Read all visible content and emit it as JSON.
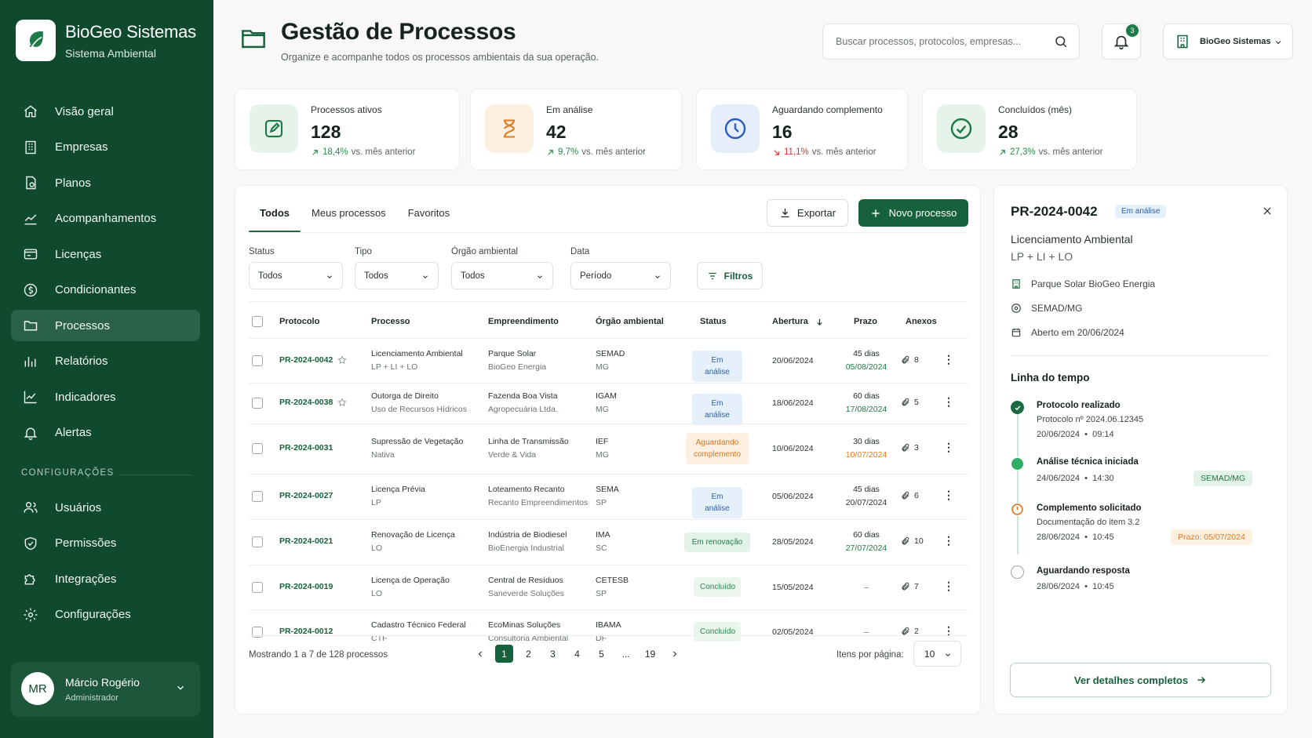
{
  "brand": {
    "title": "BioGeo Sistemas",
    "subtitle": "Sistema Ambiental"
  },
  "nav": [
    {
      "label": "Visão geral",
      "icon": "home-icon"
    },
    {
      "label": "Empresas",
      "icon": "building-icon"
    },
    {
      "label": "Planos",
      "icon": "document-icon"
    },
    {
      "label": "Acompanhamentos",
      "icon": "chart-user-icon"
    },
    {
      "label": "Licenças",
      "icon": "license-icon"
    },
    {
      "label": "Condicionantes",
      "icon": "dollar-circle-icon"
    },
    {
      "label": "Processos",
      "icon": "folder-icon",
      "active": true
    },
    {
      "label": "Relatórios",
      "icon": "bar-chart-icon"
    },
    {
      "label": "Indicadores",
      "icon": "line-chart-icon"
    },
    {
      "label": "Alertas",
      "icon": "bell-icon"
    }
  ],
  "config_section": "CONFIGURAÇÕES",
  "config_nav": [
    {
      "label": "Usuários",
      "icon": "users-icon"
    },
    {
      "label": "Permissões",
      "icon": "shield-icon"
    },
    {
      "label": "Integrações",
      "icon": "puzzle-icon"
    },
    {
      "label": "Configurações",
      "icon": "gear-icon"
    }
  ],
  "user": {
    "initials": "MR",
    "name": "Márcio Rogério",
    "role": "Administrador"
  },
  "header": {
    "title": "Gestão de Processos",
    "subtitle": "Organize e acompanhe todos os processos ambientais da sua operação.",
    "search_placeholder": "Buscar processos, protocolos, empresas...",
    "notifications": "3",
    "org": "BioGeo Sistemas"
  },
  "kpis": [
    {
      "label": "Processos ativos",
      "value": "128",
      "trend": "18,4%",
      "trend_text": "vs. mês anterior",
      "direction": "up",
      "color": "#2d8a50"
    },
    {
      "label": "Em análise",
      "value": "42",
      "trend": "9,7%",
      "trend_text": "vs. mês anterior",
      "direction": "up",
      "color": "#2d8a50"
    },
    {
      "label": "Aguardando complemento",
      "value": "16",
      "trend": "11,1%",
      "trend_text": "vs. mês anterior",
      "direction": "down",
      "color": "#d23b2f"
    },
    {
      "label": "Concluídos (mês)",
      "value": "28",
      "trend": "27,3%",
      "trend_text": "vs. mês anterior",
      "direction": "up",
      "color": "#2d8a50"
    }
  ],
  "tabs": [
    "Todos",
    "Meus processos",
    "Favoritos"
  ],
  "buttons": {
    "export": "Exportar",
    "new": "Novo processo",
    "filters": "Filtros",
    "details": "Ver detalhes completos"
  },
  "filters": [
    {
      "label": "Status",
      "value": "Todos"
    },
    {
      "label": "Tipo",
      "value": "Todos"
    },
    {
      "label": "Órgão ambiental",
      "value": "Todos"
    },
    {
      "label": "Data",
      "value": "Período"
    }
  ],
  "columns": [
    "Protocolo",
    "Processo",
    "Empreendimento",
    "Órgão ambiental",
    "Status",
    "Abertura",
    "Prazo",
    "Anexos"
  ],
  "rows": [
    {
      "protocol": "PR-2024-0042",
      "star": true,
      "process": "Licenciamento Ambiental",
      "process_sub": "LP + LI + LO",
      "enterprise": "Parque Solar",
      "enterprise_sub": "BioGeo Energia",
      "agency": "SEMAD",
      "state": "MG",
      "status": "Em análise",
      "status_type": "analise",
      "opened": "20/06/2024",
      "prazo_days": "45 dias",
      "prazo_date": "05/08/2024",
      "prazo_color": "#1f7a45",
      "attachments": "8"
    },
    {
      "protocol": "PR-2024-0038",
      "star": true,
      "process": "Outorga de Direito",
      "process_sub": "Uso de Recursos Hídricos",
      "enterprise": "Fazenda Boa Vista",
      "enterprise_sub": "Agropecuária Ltda.",
      "agency": "IGAM",
      "state": "MG",
      "status": "Em análise",
      "status_type": "analise",
      "opened": "18/06/2024",
      "prazo_days": "60 dias",
      "prazo_date": "17/08/2024",
      "prazo_color": "#1f7a45",
      "attachments": "5"
    },
    {
      "protocol": "PR-2024-0031",
      "star": false,
      "process": "Supressão de Vegetação",
      "process_sub": "Nativa",
      "enterprise": "Linha de Transmissão",
      "enterprise_sub": "Verde & Vida",
      "agency": "IEF",
      "state": "MG",
      "status": "Aguardando complemento",
      "status_type": "aguard",
      "opened": "10/06/2024",
      "prazo_days": "30 dias",
      "prazo_date": "10/07/2024",
      "prazo_color": "#e07a1f",
      "attachments": "3"
    },
    {
      "protocol": "PR-2024-0027",
      "star": false,
      "process": "Licença Prévia",
      "process_sub": "LP",
      "enterprise": "Loteamento Recanto",
      "enterprise_sub": "Recanto Empreendimentos",
      "agency": "SEMA",
      "state": "SP",
      "status": "Em análise",
      "status_type": "analise",
      "opened": "05/06/2024",
      "prazo_days": "45 dias",
      "prazo_date": "20/07/2024",
      "prazo_color": "#2a3530",
      "attachments": "6"
    },
    {
      "protocol": "PR-2024-0021",
      "star": false,
      "process": "Renovação de Licença",
      "process_sub": "LO",
      "enterprise": "Indústria de Biodiesel",
      "enterprise_sub": "BioEnergia Industrial",
      "agency": "IMA",
      "state": "SC",
      "status": "Em renovação",
      "status_type": "renov",
      "opened": "28/05/2024",
      "prazo_days": "60 dias",
      "prazo_date": "27/07/2024",
      "prazo_color": "#1f7a45",
      "attachments": "10"
    },
    {
      "protocol": "PR-2024-0019",
      "star": false,
      "process": "Licença de Operação",
      "process_sub": "LO",
      "enterprise": "Central de Resíduos",
      "enterprise_sub": "Saneverde Soluções",
      "agency": "CETESB",
      "state": "SP",
      "status": "Concluído",
      "status_type": "concl",
      "opened": "15/05/2024",
      "prazo_days": "–",
      "prazo_date": "",
      "prazo_color": "#2a3530",
      "attachments": "7"
    },
    {
      "protocol": "PR-2024-0012",
      "star": false,
      "process": "Cadastro Técnico Federal",
      "process_sub": "CTF",
      "enterprise": "EcoMinas Soluções",
      "enterprise_sub": "Consultoria Ambiental",
      "agency": "IBAMA",
      "state": "DF",
      "status": "Concluído",
      "status_type": "concl",
      "opened": "02/05/2024",
      "prazo_days": "–",
      "prazo_date": "",
      "prazo_color": "#2a3530",
      "attachments": "2"
    }
  ],
  "pagination": {
    "showing": "Mostrando 1 a 7 de 128 processos",
    "pages": [
      "1",
      "2",
      "3",
      "4",
      "5",
      "...",
      "19"
    ],
    "active": "1",
    "per_page_label": "Itens por página:",
    "per_page": "10"
  },
  "detail": {
    "id": "PR-2024-0042",
    "status": "Em análise",
    "title": "Licenciamento Ambiental",
    "subtitle": "LP + LI + LO",
    "enterprise": "Parque Solar BioGeo Energia",
    "agency": "SEMAD/MG",
    "opened": "Aberto em 20/06/2024",
    "timeline_title": "Linha do tempo",
    "timeline": [
      {
        "title": "Protocolo realizado",
        "line1": "Protocolo nº 2024.06.12345",
        "date": "20/06/2024",
        "time": "09:14",
        "state": "done",
        "tag": ""
      },
      {
        "title": "Análise técnica iniciada",
        "line1": "",
        "date": "24/06/2024",
        "time": "14:30",
        "state": "current",
        "tag": "SEMAD/MG"
      },
      {
        "title": "Complemento solicitado",
        "line1": "Documentação do item 3.2",
        "date": "28/06/2024",
        "time": "10:45",
        "state": "warning",
        "tag": "Prazo: 05/07/2024"
      },
      {
        "title": "Aguardando resposta",
        "line1": "",
        "date": "28/06/2024",
        "time": "10:45",
        "state": "pending",
        "tag": ""
      }
    ]
  }
}
